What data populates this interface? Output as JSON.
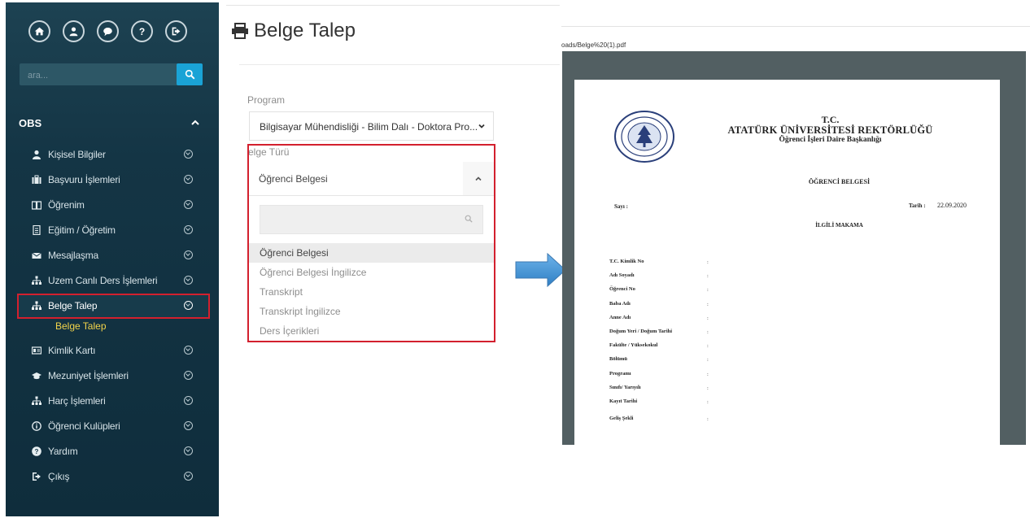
{
  "sidebar": {
    "search_placeholder": "ara...",
    "section_title": "OBS",
    "top_icons": [
      "home-icon",
      "user-icon",
      "chat-icon",
      "help-icon",
      "logout-icon"
    ],
    "items": [
      {
        "label": "Kişisel Bilgiler",
        "icon": "person-icon"
      },
      {
        "label": "Başvuru İşlemleri",
        "icon": "briefcase-icon"
      },
      {
        "label": "Öğrenim",
        "icon": "book-icon"
      },
      {
        "label": "Eğitim / Öğretim",
        "icon": "document-icon"
      },
      {
        "label": "Mesajlaşma",
        "icon": "envelope-icon"
      },
      {
        "label": "Uzem Canlı Ders İşlemleri",
        "icon": "sitemap-icon"
      },
      {
        "label": "Belge Talep",
        "icon": "sitemap-icon"
      },
      {
        "label": "Kimlik Kartı",
        "icon": "id-card-icon"
      },
      {
        "label": "Mezuniyet İşlemleri",
        "icon": "graduation-cap-icon"
      },
      {
        "label": "Harç İşlemleri",
        "icon": "sitemap-icon"
      },
      {
        "label": "Öğrenci Kulüpleri",
        "icon": "info-circle-icon"
      },
      {
        "label": "Yardım",
        "icon": "question-circle-icon"
      },
      {
        "label": "Çıkış",
        "icon": "sign-out-icon"
      }
    ],
    "active_item": "Belge Talep",
    "submenu_label": "Belge Talep"
  },
  "form": {
    "title": "Belge Talep",
    "program_label": "Program",
    "program_value": "Bilgisayar Mühendisliği - Bilim Dalı - Doktora Pro...",
    "doc_type_label": "elge Türü",
    "doc_type_value": "Öğrenci Belgesi",
    "search_value": "",
    "options": [
      "Öğrenci Belgesi",
      "Öğrenci Belgesi İngilizce",
      "Transkript",
      "Transkript İngilizce",
      "Ders İçerikleri"
    ]
  },
  "pdf": {
    "url": "oads/Belge%20(1).pdf",
    "tc": "T.C.",
    "university": "ATATÜRK ÜNİVERSİTESİ REKTÖRLÜĞÜ",
    "department": "Öğrenci İşleri Daire Başkanlığı",
    "doc_title": "ÖĞRENCİ BELGESİ",
    "sayi_label": "Sayı :",
    "tarih_label": "Tarih :",
    "tarih_value": "22.09.2020",
    "recipient": "İLGİLİ MAKAMA",
    "fields": [
      "T.C. Kimlik No",
      "Adı Soyadı",
      "Öğrenci No",
      "Baba Adı",
      "Anne Adı",
      "Doğum Yeri / Doğum Tarihi",
      "Fakülte / Yüksekokul",
      "Bölümü",
      "Programı",
      "Sınıfı/ Yarıyılı",
      "Kayıt Tarihi",
      "Geliş Şekli"
    ],
    "colon": ":"
  },
  "colors": {
    "sidebar_bg": "#143545",
    "highlight": "#d3202e",
    "search_button": "#1aa3d6",
    "submenu_text": "#f2d34a",
    "arrow": "#3a8fd3"
  }
}
